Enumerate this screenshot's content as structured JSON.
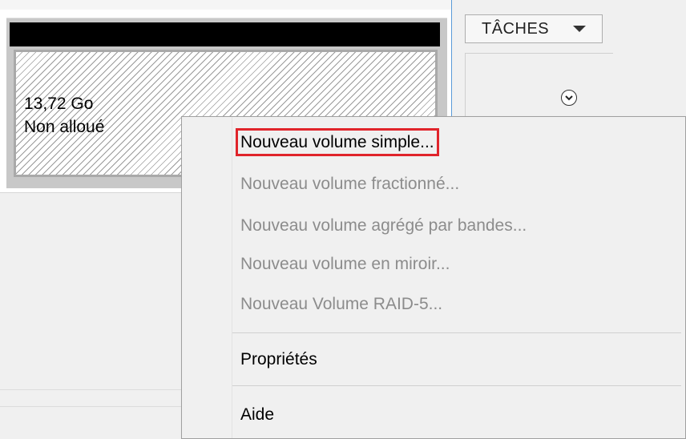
{
  "tasks_button": {
    "label": "TÂCHES"
  },
  "disk": {
    "unallocated_size": "13,72 Go",
    "unallocated_status": "Non alloué"
  },
  "context_menu": {
    "items": [
      {
        "label": "Nouveau volume simple...",
        "enabled": true,
        "highlighted": true
      },
      {
        "label": "Nouveau volume fractionné...",
        "enabled": false
      },
      {
        "label": "Nouveau volume agrégé par bandes...",
        "enabled": false
      },
      {
        "label": "Nouveau volume en miroir...",
        "enabled": false
      },
      {
        "label": "Nouveau Volume RAID-5...",
        "enabled": false
      },
      {
        "label": "Propriétés",
        "enabled": true
      },
      {
        "label": "Aide",
        "enabled": true
      }
    ]
  },
  "colors": {
    "highlight_outline": "#e0242b",
    "disabled_text": "#8c8c8c",
    "pane_divider": "#5a9bd8"
  },
  "icons": {
    "tasks_dropdown": "chevron-down-icon",
    "expand": "chevron-circle-down-icon"
  }
}
